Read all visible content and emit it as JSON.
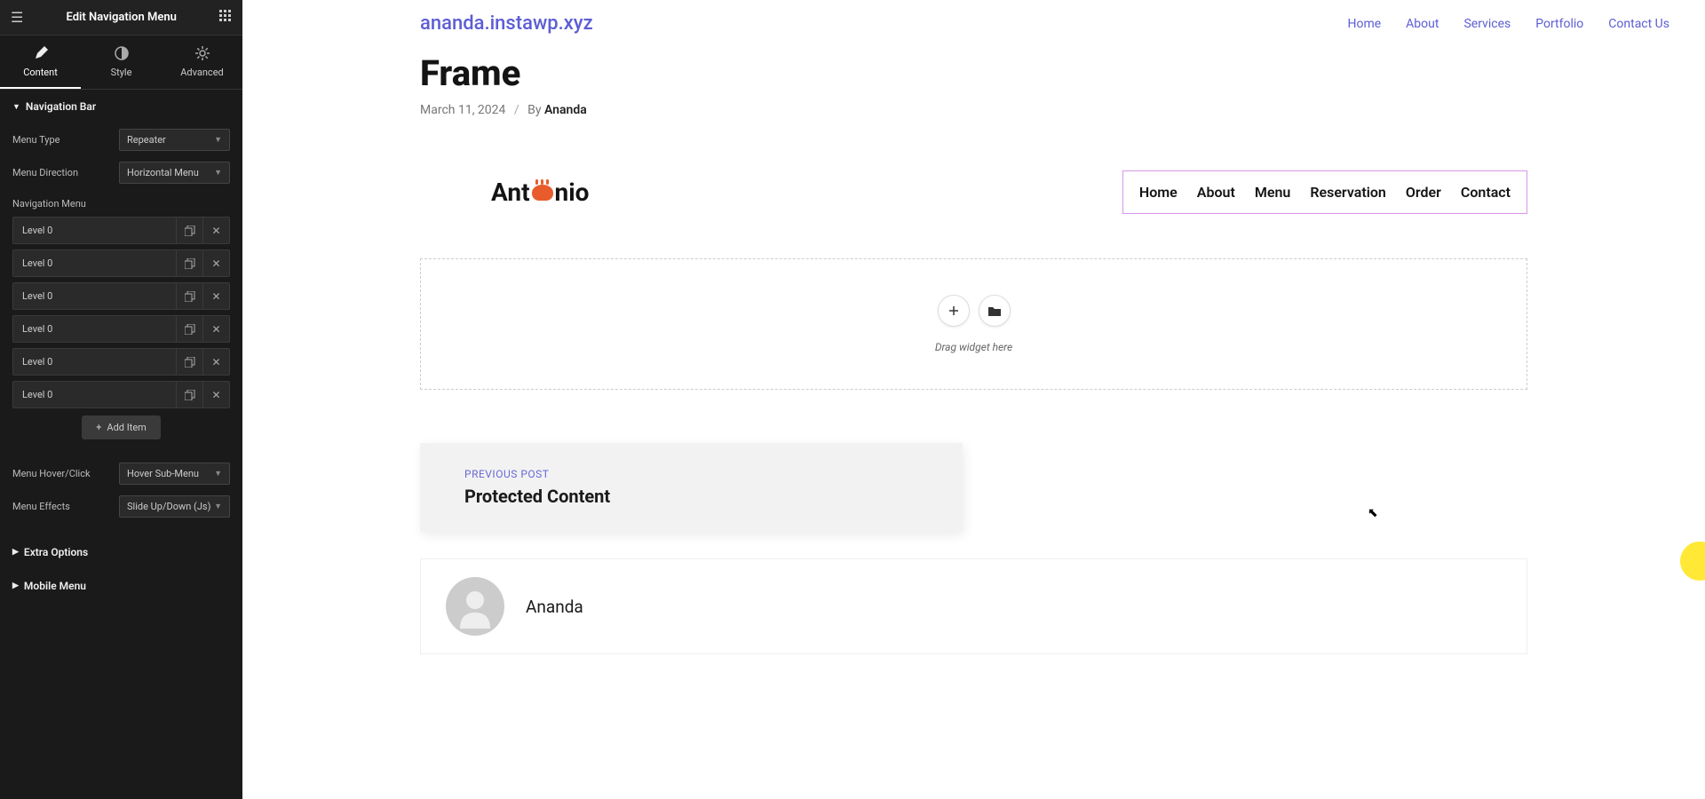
{
  "sidebar": {
    "title": "Edit Navigation Menu",
    "tabs": {
      "content": "Content",
      "style": "Style",
      "advanced": "Advanced"
    },
    "sections": {
      "navbar": "Navigation Bar",
      "extra": "Extra Options",
      "mobile": "Mobile Menu"
    },
    "controls": {
      "menu_type_label": "Menu Type",
      "menu_type_value": "Repeater",
      "menu_direction_label": "Menu Direction",
      "menu_direction_value": "Horizontal Menu",
      "navigation_menu_label": "Navigation Menu",
      "hover_click_label": "Menu Hover/Click",
      "hover_click_value": "Hover Sub-Menu",
      "effects_label": "Menu Effects",
      "effects_value": "Slide Up/Down (Js)",
      "add_item": "Add Item"
    },
    "items": [
      {
        "title": "Level 0"
      },
      {
        "title": "Level 0"
      },
      {
        "title": "Level 0"
      },
      {
        "title": "Level 0"
      },
      {
        "title": "Level 0"
      },
      {
        "title": "Level 0"
      }
    ]
  },
  "canvas": {
    "site_name": "ananda.instawp.xyz",
    "top_links": [
      "Home",
      "About",
      "Services",
      "Portfolio",
      "Contact Us"
    ],
    "page_title": "Frame",
    "meta_date": "March 11, 2024",
    "meta_by": "By",
    "meta_author": "Ananda",
    "logo_pre": "Ant",
    "logo_post": "nio",
    "header_nav": [
      "Home",
      "About",
      "Menu",
      "Reservation",
      "Order",
      "Contact"
    ],
    "dropzone_text": "Drag widget here",
    "prev_label": "PREVIOUS POST",
    "prev_title": "Protected Content",
    "author_name": "Ananda"
  }
}
